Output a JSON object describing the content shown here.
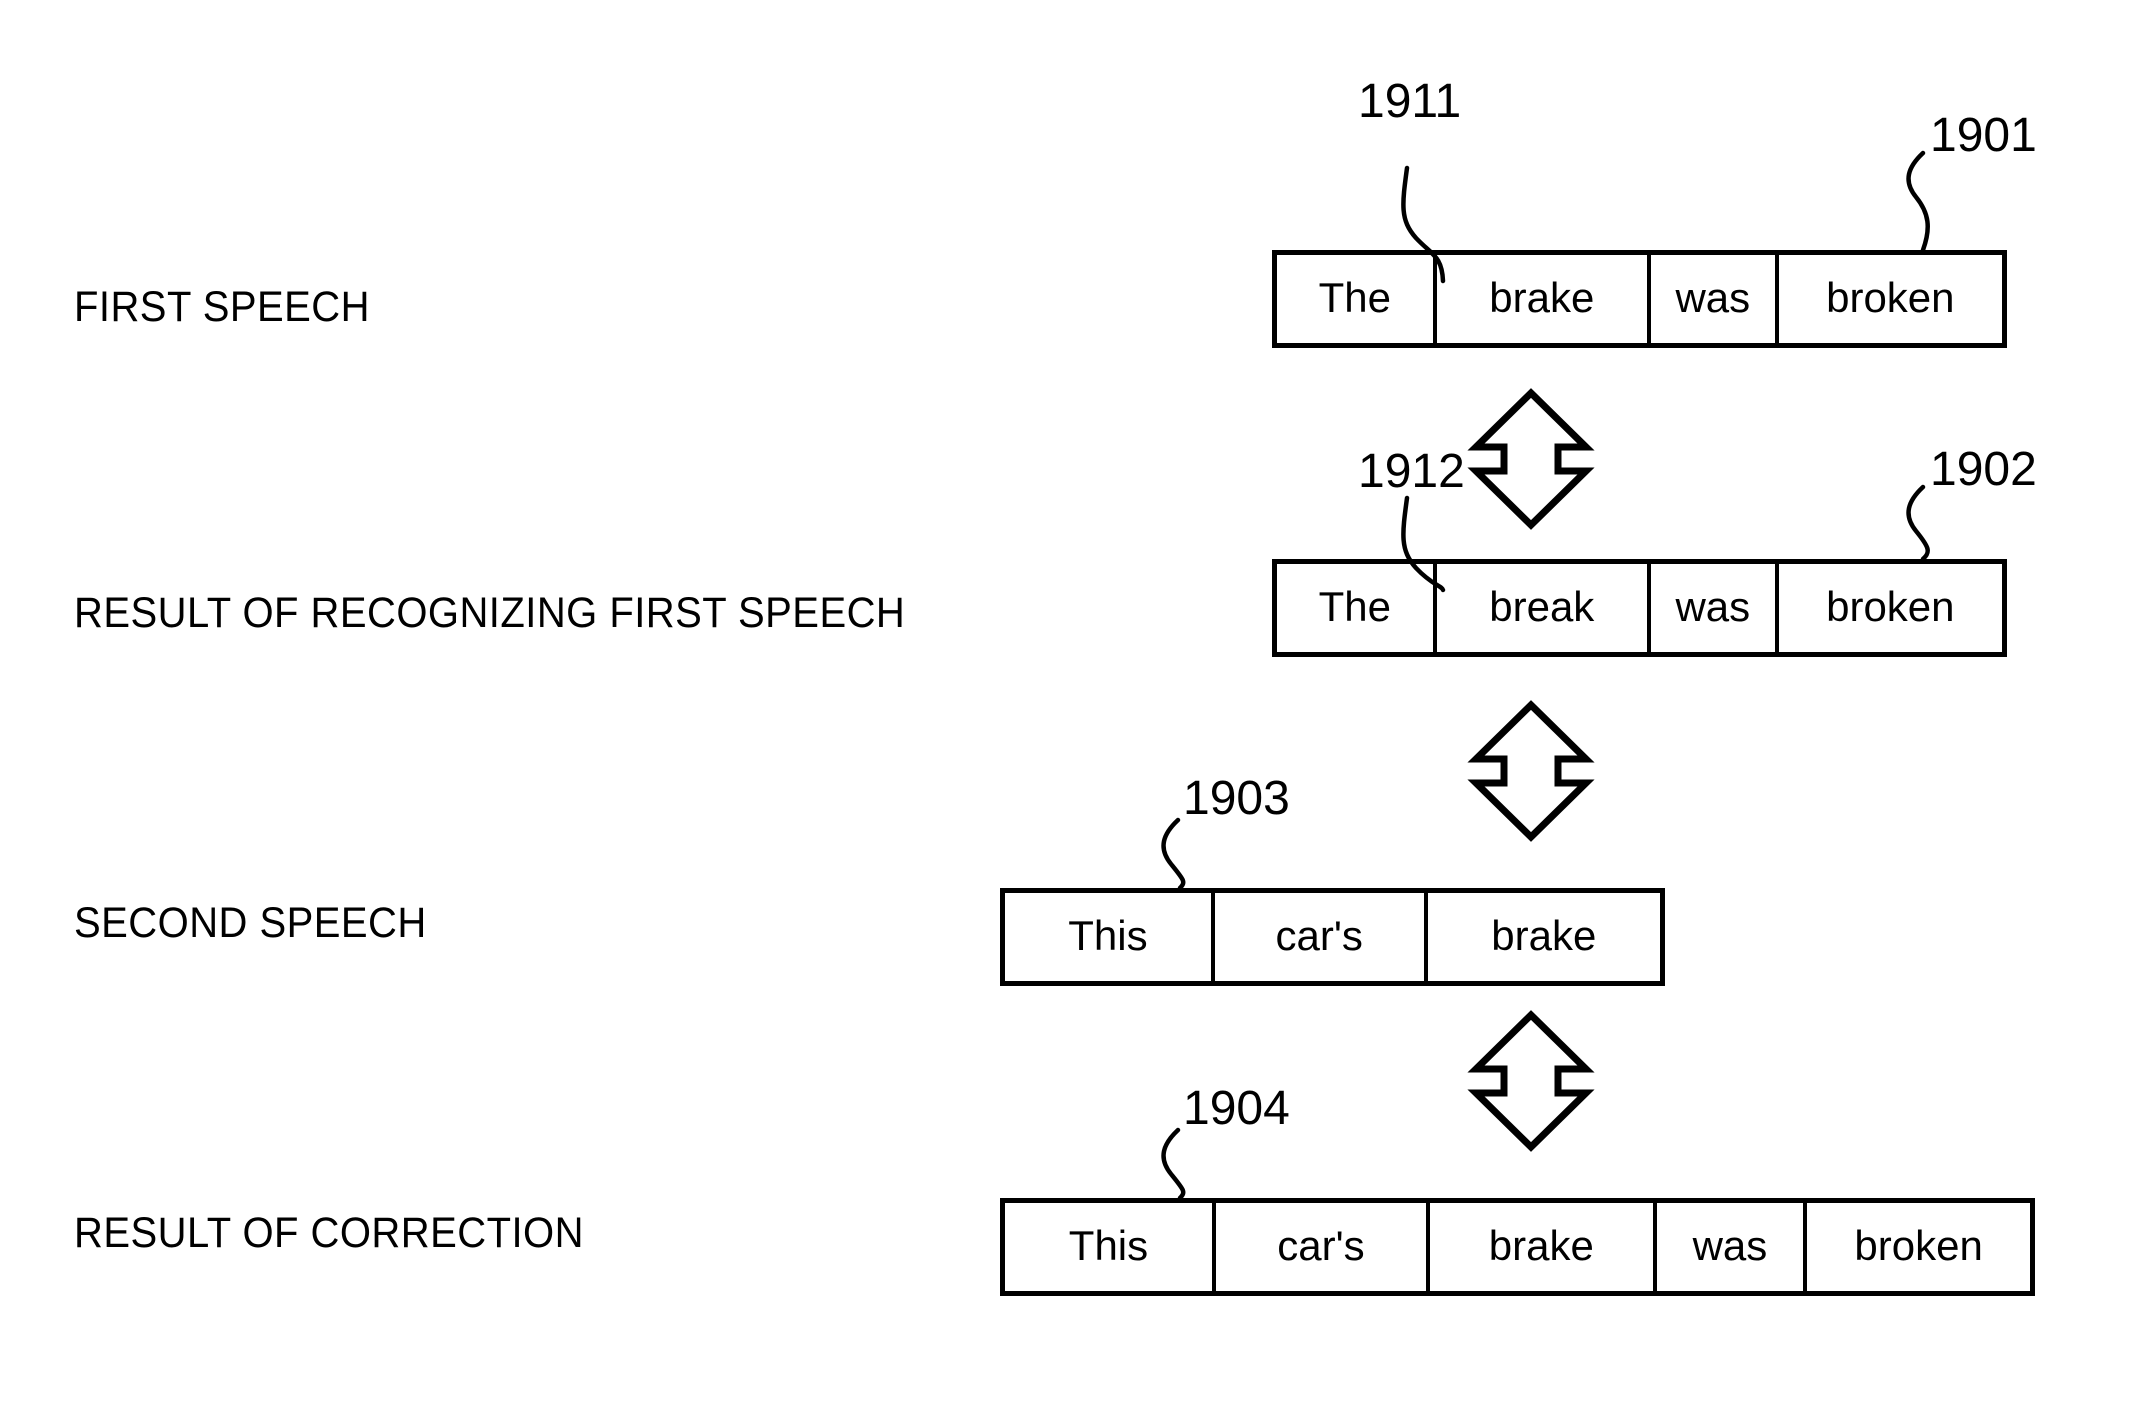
{
  "figure": {
    "kind": "patent-diagram",
    "background_color": "#ffffff",
    "line_color": "#000000"
  },
  "rows": [
    {
      "label": "FIRST SPEECH",
      "ref": "1901",
      "inner_ref": "1911",
      "words": [
        "The",
        "brake",
        "was",
        "broken"
      ]
    },
    {
      "label": "RESULT OF RECOGNIZING FIRST SPEECH",
      "ref": "1902",
      "inner_ref": "1912",
      "words": [
        "The",
        "break",
        "was",
        "broken"
      ]
    },
    {
      "label": "SECOND SPEECH",
      "ref": "1903",
      "inner_ref": "",
      "words": [
        "This",
        "car's",
        "brake"
      ]
    },
    {
      "label": "RESULT OF CORRECTION",
      "ref": "1904",
      "inner_ref": "",
      "words": [
        "This",
        "car's",
        "brake",
        "was",
        "broken"
      ]
    }
  ],
  "connectors": [
    {
      "name": "arrow-first-speech-to-recognition",
      "icon": "double-headed-vertical-arrow-icon"
    },
    {
      "name": "arrow-recognition-to-second-speech",
      "icon": "double-headed-vertical-arrow-icon"
    },
    {
      "name": "arrow-second-speech-to-correction",
      "icon": "double-headed-vertical-arrow-icon"
    }
  ]
}
